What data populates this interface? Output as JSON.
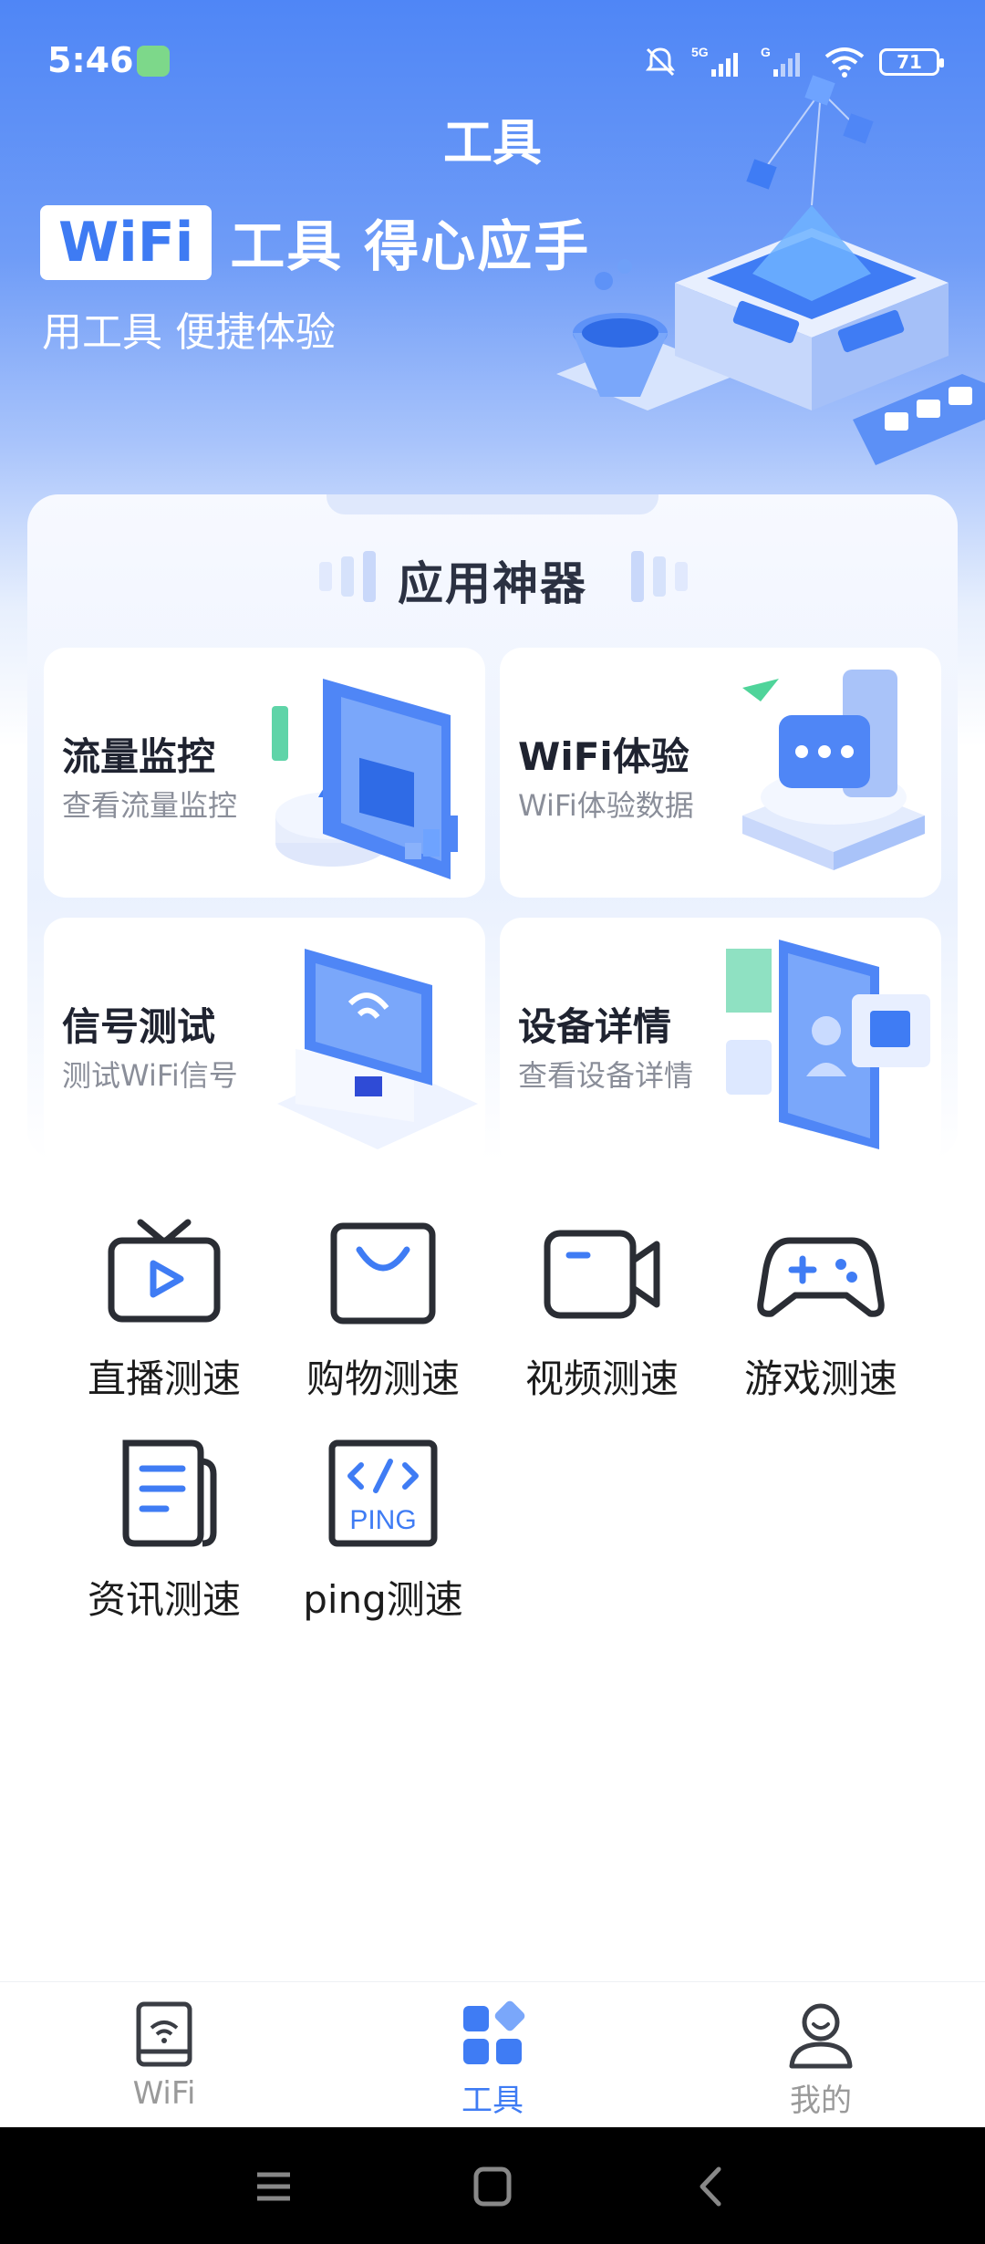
{
  "status": {
    "time": "5:46",
    "battery": "71",
    "signal1": "5G",
    "signal2": "G"
  },
  "header": {
    "title": "工具"
  },
  "hero": {
    "badge": "WiFi",
    "slogan": "工具 得心应手",
    "subtitle": "用工具 便捷体验"
  },
  "section": {
    "title": "应用神器"
  },
  "features": [
    {
      "title": "流量监控",
      "subtitle": "查看流量监控"
    },
    {
      "title": "WiFi体验",
      "subtitle": "WiFi体验数据"
    },
    {
      "title": "信号测试",
      "subtitle": "测试WiFi信号"
    },
    {
      "title": "设备详情",
      "subtitle": "查看设备详情"
    }
  ],
  "speed_tests": [
    {
      "label": "直播测速",
      "icon": "live-tv-icon"
    },
    {
      "label": "购物测速",
      "icon": "shopping-bag-icon"
    },
    {
      "label": "视频测速",
      "icon": "video-camera-icon"
    },
    {
      "label": "游戏测速",
      "icon": "gamepad-icon"
    },
    {
      "label": "资讯测速",
      "icon": "news-document-icon"
    },
    {
      "label": "ping测速",
      "icon": "ping-code-icon",
      "icon_text": "PING"
    }
  ],
  "nav": [
    {
      "label": "WiFi",
      "icon": "wifi-tab-icon"
    },
    {
      "label": "工具",
      "icon": "tools-grid-icon",
      "active": true
    },
    {
      "label": "我的",
      "icon": "profile-icon"
    }
  ],
  "colors": {
    "accent": "#3f7cf4",
    "hero_top": "#4f86f6",
    "icon_stroke": "#2a2d34"
  }
}
